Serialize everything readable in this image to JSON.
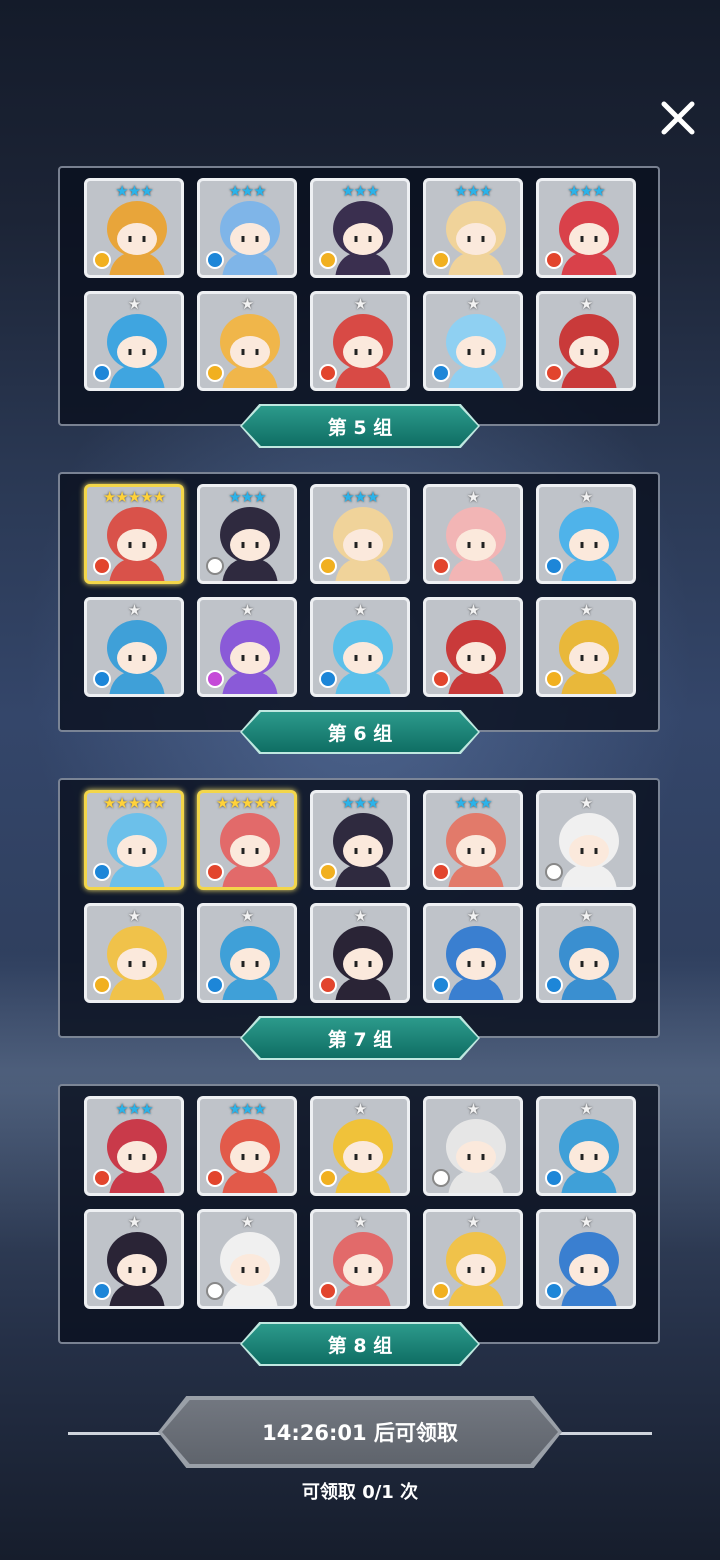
{
  "close_icon": "close-icon",
  "groups": [
    {
      "label": "第 5 组",
      "cards": [
        {
          "stars": "★★★",
          "star_color": "blue",
          "element": "wind",
          "hue": "#e8a53a",
          "legend": false
        },
        {
          "stars": "★★★",
          "star_color": "blue",
          "element": "water",
          "hue": "#7fb5e8",
          "legend": false
        },
        {
          "stars": "★★★",
          "star_color": "blue",
          "element": "wind",
          "hue": "#3a2f4f",
          "legend": false
        },
        {
          "stars": "★★★",
          "star_color": "blue",
          "element": "wind",
          "hue": "#f0d39a",
          "legend": false
        },
        {
          "stars": "★★★",
          "star_color": "blue",
          "element": "fire",
          "hue": "#d9414a",
          "legend": false
        },
        {
          "stars": "★",
          "star_color": "gray",
          "element": "water",
          "hue": "#3fa5e0",
          "legend": false
        },
        {
          "stars": "★",
          "star_color": "gray",
          "element": "wind",
          "hue": "#f0b64a",
          "legend": false
        },
        {
          "stars": "★",
          "star_color": "gray",
          "element": "fire",
          "hue": "#d84a45",
          "legend": false
        },
        {
          "stars": "★",
          "star_color": "gray",
          "element": "water",
          "hue": "#8fd0f2",
          "legend": false
        },
        {
          "stars": "★",
          "star_color": "gray",
          "element": "fire",
          "hue": "#c93a3a",
          "legend": false
        }
      ]
    },
    {
      "label": "第 6 组",
      "cards": [
        {
          "stars": "★★★★★",
          "star_color": "gold",
          "element": "fire",
          "hue": "#d9524a",
          "legend": true
        },
        {
          "stars": "★★★",
          "star_color": "blue",
          "element": "light",
          "hue": "#2f2a3f",
          "legend": false
        },
        {
          "stars": "★★★",
          "star_color": "blue",
          "element": "wind",
          "hue": "#f0d39a",
          "legend": false
        },
        {
          "stars": "★",
          "star_color": "gray",
          "element": "fire",
          "hue": "#f2b5b5",
          "legend": false
        },
        {
          "stars": "★",
          "star_color": "gray",
          "element": "water",
          "hue": "#4fb3ea",
          "legend": false
        },
        {
          "stars": "★",
          "star_color": "gray",
          "element": "water",
          "hue": "#3fa0d8",
          "legend": false
        },
        {
          "stars": "★",
          "star_color": "gray",
          "element": "dark",
          "hue": "#8a5ad8",
          "legend": false
        },
        {
          "stars": "★",
          "star_color": "gray",
          "element": "water",
          "hue": "#5bc0ea",
          "legend": false
        },
        {
          "stars": "★",
          "star_color": "gray",
          "element": "fire",
          "hue": "#c93a3a",
          "legend": false
        },
        {
          "stars": "★",
          "star_color": "gray",
          "element": "wind",
          "hue": "#e9b83a",
          "legend": false
        }
      ]
    },
    {
      "label": "第 7 组",
      "cards": [
        {
          "stars": "★★★★★",
          "star_color": "gold",
          "element": "water",
          "hue": "#6cc0ea",
          "legend": true
        },
        {
          "stars": "★★★★★",
          "star_color": "gold",
          "element": "fire",
          "hue": "#e26a6a",
          "legend": true
        },
        {
          "stars": "★★★",
          "star_color": "blue",
          "element": "wind",
          "hue": "#2f2a3f",
          "legend": false
        },
        {
          "stars": "★★★",
          "star_color": "blue",
          "element": "fire",
          "hue": "#e27a6a",
          "legend": false
        },
        {
          "stars": "★",
          "star_color": "gray",
          "element": "light",
          "hue": "#f0f0f0",
          "legend": false
        },
        {
          "stars": "★",
          "star_color": "gray",
          "element": "wind",
          "hue": "#f0c24a",
          "legend": false
        },
        {
          "stars": "★",
          "star_color": "gray",
          "element": "water",
          "hue": "#3fa0d8",
          "legend": false
        },
        {
          "stars": "★",
          "star_color": "gray",
          "element": "fire",
          "hue": "#2a2436",
          "legend": false
        },
        {
          "stars": "★",
          "star_color": "gray",
          "element": "water",
          "hue": "#3a7fd0",
          "legend": false
        },
        {
          "stars": "★",
          "star_color": "gray",
          "element": "water",
          "hue": "#3a8fd0",
          "legend": false
        }
      ]
    },
    {
      "label": "第 8 组",
      "cards": [
        {
          "stars": "★★★",
          "star_color": "blue",
          "element": "fire",
          "hue": "#c93a4a",
          "legend": false
        },
        {
          "stars": "★★★",
          "star_color": "blue",
          "element": "fire",
          "hue": "#e25a4a",
          "legend": false
        },
        {
          "stars": "★",
          "star_color": "gray",
          "element": "wind",
          "hue": "#f0c23a",
          "legend": false
        },
        {
          "stars": "★",
          "star_color": "gray",
          "element": "light",
          "hue": "#e6e6e6",
          "legend": false
        },
        {
          "stars": "★",
          "star_color": "gray",
          "element": "water",
          "hue": "#3fa0d8",
          "legend": false
        },
        {
          "stars": "★",
          "star_color": "gray",
          "element": "water",
          "hue": "#2a2436",
          "legend": false
        },
        {
          "stars": "★",
          "star_color": "gray",
          "element": "light",
          "hue": "#f0f0f0",
          "legend": false
        },
        {
          "stars": "★",
          "star_color": "gray",
          "element": "fire",
          "hue": "#e26a6a",
          "legend": false
        },
        {
          "stars": "★",
          "star_color": "gray",
          "element": "wind",
          "hue": "#f0c24a",
          "legend": false
        },
        {
          "stars": "★",
          "star_color": "gray",
          "element": "water",
          "hue": "#3a7fd0",
          "legend": false
        }
      ]
    }
  ],
  "claim": {
    "button_text": "14:26:01 后可领取",
    "count_text": "可领取 0/1 次"
  }
}
